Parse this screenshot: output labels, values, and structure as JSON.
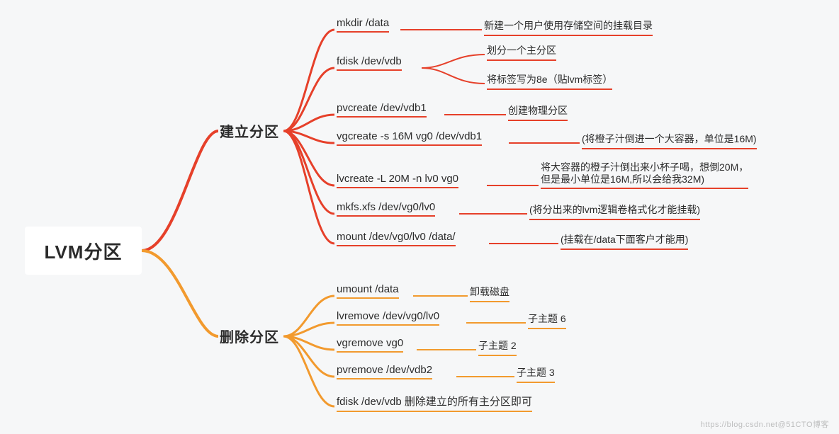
{
  "root": {
    "title": "LVM分区"
  },
  "branches": {
    "build": {
      "title": "建立分区"
    },
    "delete": {
      "title": "删除分区"
    }
  },
  "build_nodes": {
    "mkdir": {
      "cmd": "mkdir /data",
      "desc": "新建一个用户使用存储空间的挂载目录"
    },
    "fdisk": {
      "cmd": "fdisk /dev/vdb",
      "desc_a": "划分一个主分区",
      "desc_b": "将标签写为8e（贴lvm标签）"
    },
    "pvcreate": {
      "cmd": "pvcreate /dev/vdb1",
      "desc": "创建物理分区"
    },
    "vgcreate": {
      "cmd": "vgcreate -s 16M vg0 /dev/vdb1",
      "desc": "(将橙子汁倒进一个大容器，单位是16M)"
    },
    "lvcreate": {
      "cmd": "lvcreate -L 20M -n lv0 vg0",
      "desc": "将大容器的橙子汁倒出来小杯子喝，想倒20M，\n但是最小单位是16M,所以会给我32M)"
    },
    "mkfs": {
      "cmd": "mkfs.xfs /dev/vg0/lv0",
      "desc": "(将分出来的lvm逻辑卷格式化才能挂载)"
    },
    "mount": {
      "cmd": "mount /dev/vg0/lv0 /data/",
      "desc": "(挂载在/data下面客户才能用)"
    }
  },
  "delete_nodes": {
    "umount": {
      "cmd": "umount /data",
      "desc": "卸载磁盘"
    },
    "lvremove": {
      "cmd": "lvremove /dev/vg0/lv0",
      "desc": "子主题 6"
    },
    "vgremove": {
      "cmd": "vgremove vg0",
      "desc": "子主题 2"
    },
    "pvremove": {
      "cmd": "pvremove /dev/vdb2",
      "desc": "子主题 3"
    },
    "fdiskdel": {
      "cmd": "fdisk /dev/vdb 删除建立的所有主分区即可"
    }
  },
  "watermark": "https://blog.csdn.net@51CTO博客"
}
